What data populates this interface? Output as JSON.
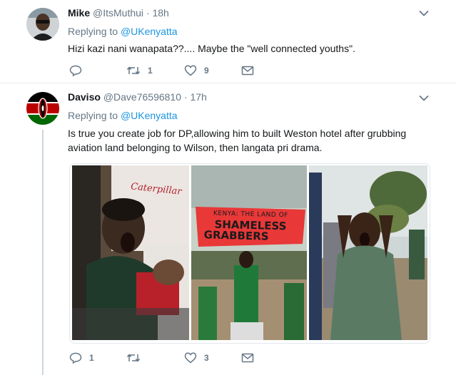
{
  "tweets": [
    {
      "name": "Mike",
      "handle": "@ItsMuthui",
      "separator": "·",
      "time": "18h",
      "replying_prefix": "Replying to",
      "replying_to": "@UKenyatta",
      "text": "Hizi kazi nani wanapata??.... Maybe the \"well connected youths\".",
      "actions": {
        "replies": "",
        "retweets": "1",
        "likes": "9"
      }
    },
    {
      "name": "Daviso",
      "handle": "@Dave76596810",
      "separator": "·",
      "time": "17h",
      "replying_prefix": "Replying to",
      "replying_to": "@UKenyatta",
      "text_line1": "Is true you create job for DP,allowing him to built Weston hotel after grubbing",
      "text_line2": "aviation land belonging to Wilson, then langata pri drama.",
      "photo_sign_line1": "KENYA: THE LAND OF",
      "photo_sign_line2": "SHAMELESS",
      "photo_sign_line3": "GRABBERS",
      "photo_shirt_text": "Caterpillar",
      "actions": {
        "replies": "1",
        "retweets": "",
        "likes": "3"
      }
    }
  ],
  "colors": {
    "link": "#1b95e0",
    "muted": "#657786",
    "border": "#e6ecf0",
    "thread": "#ccd6dd"
  }
}
